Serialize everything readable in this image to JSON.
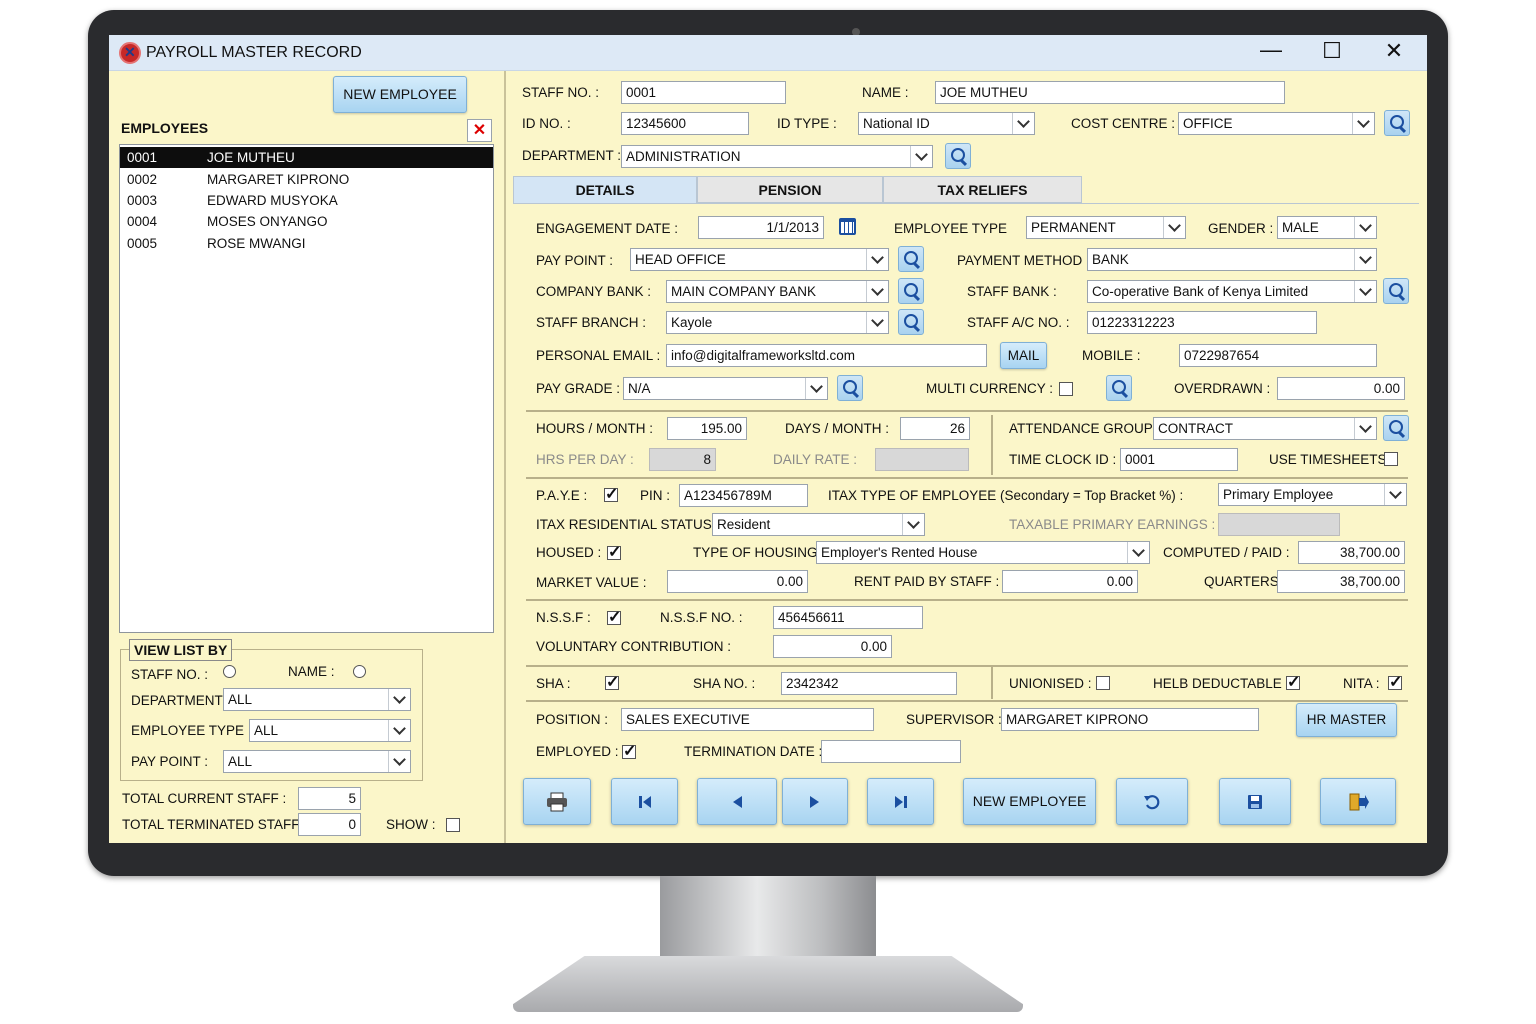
{
  "window": {
    "title": "PAYROLL MASTER RECORD"
  },
  "left": {
    "new_employee": "NEW EMPLOYEE",
    "employees_label": "EMPLOYEES",
    "employees": [
      {
        "no": "0001",
        "name": "JOE MUTHEU"
      },
      {
        "no": "0002",
        "name": "MARGARET KIPRONO"
      },
      {
        "no": "0003",
        "name": "EDWARD MUSYOKA"
      },
      {
        "no": "0004",
        "name": "MOSES ONYANGO"
      },
      {
        "no": "0005",
        "name": "ROSE MWANGI"
      }
    ],
    "view_list_by": "VIEW LIST BY",
    "staff_no_label": "STAFF NO. :",
    "name_label": "NAME :",
    "department_label": "DEPARTMENT",
    "department_value": "ALL",
    "employee_type_label": "EMPLOYEE TYPE",
    "employee_type_value": "ALL",
    "pay_point_label": "PAY POINT :",
    "pay_point_value": "ALL",
    "total_current_label": "TOTAL CURRENT STAFF :",
    "total_current_value": "5",
    "total_terminated_label": "TOTAL TERMINATED STAFF :",
    "total_terminated_value": "0",
    "show_label": "SHOW :"
  },
  "header": {
    "staff_no_label": "STAFF NO. :",
    "staff_no": "0001",
    "name_label": "NAME :",
    "name": "JOE MUTHEU",
    "id_no_label": "ID NO. :",
    "id_no": "12345600",
    "id_type_label": "ID TYPE :",
    "id_type": "National ID",
    "cost_centre_label": "COST CENTRE :",
    "cost_centre": "OFFICE",
    "department_label": "DEPARTMENT :",
    "department": "ADMINISTRATION"
  },
  "tabs": [
    "DETAILS",
    "PENSION",
    "TAX RELIEFS"
  ],
  "details": {
    "engagement_date_label": "ENGAGEMENT DATE :",
    "engagement_date": "1/1/2013",
    "employee_type_label": "EMPLOYEE TYPE",
    "employee_type": "PERMANENT",
    "gender_label": "GENDER :",
    "gender": "MALE",
    "pay_point_label": "PAY POINT :",
    "pay_point": "HEAD OFFICE",
    "payment_method_label": "PAYMENT METHOD :",
    "payment_method": "BANK",
    "company_bank_label": "COMPANY BANK :",
    "company_bank": "MAIN COMPANY BANK",
    "staff_bank_label": "STAFF BANK :",
    "staff_bank": "Co-operative Bank of Kenya Limited",
    "staff_branch_label": "STAFF BRANCH :",
    "staff_branch": "Kayole",
    "staff_ac_label": "STAFF A/C NO. :",
    "staff_ac": "01223312223",
    "email_label": "PERSONAL EMAIL :",
    "email": "info@digitalframeworksltd.com",
    "mail_button": "MAIL",
    "mobile_label": "MOBILE :",
    "mobile": "0722987654",
    "pay_grade_label": "PAY GRADE :",
    "pay_grade": "N/A",
    "multi_currency_label": "MULTI CURRENCY :",
    "overdrawn_label": "OVERDRAWN :",
    "overdrawn": "0.00",
    "hours_month_label": "HOURS / MONTH :",
    "hours_month": "195.00",
    "days_month_label": "DAYS / MONTH :",
    "days_month": "26",
    "attendance_group_label": "ATTENDANCE GROUP :",
    "attendance_group": "CONTRACT",
    "hrs_per_day_label": "HRS PER DAY :",
    "hrs_per_day": "8",
    "daily_rate_label": "DAILY RATE :",
    "time_clock_label": "TIME CLOCK ID :",
    "time_clock": "0001",
    "use_timesheets_label": "USE TIMESHEETS",
    "paye_label": "P.A.Y.E :",
    "pin_label": "PIN :",
    "pin": "A123456789M",
    "itax_type_label": "ITAX TYPE OF EMPLOYEE (Secondary = Top Bracket %) :",
    "itax_type": "Primary Employee",
    "itax_res_label": "ITAX RESIDENTIAL STATUS :",
    "itax_res": "Resident",
    "taxable_primary_label": "TAXABLE PRIMARY EARNINGS :",
    "housed_label": "HOUSED :",
    "housing_type_label": "TYPE OF HOUSING",
    "housing_type": "Employer's Rented House",
    "computed_label": "COMPUTED / PAID :",
    "computed": "38,700.00",
    "market_value_label": "MARKET VALUE :",
    "market_value": "0.00",
    "rent_paid_label": "RENT PAID BY STAFF :",
    "rent_paid": "0.00",
    "quarters_label": "QUARTERS :",
    "quarters": "38,700.00",
    "nssf_label": "N.S.S.F :",
    "nssf_no_label": "N.S.S.F NO. :",
    "nssf_no": "456456611",
    "voluntary_label": "VOLUNTARY CONTRIBUTION :",
    "voluntary": "0.00",
    "sha_label": "SHA :",
    "sha_no_label": "SHA NO. :",
    "sha_no": "2342342",
    "unionised_label": "UNIONISED :",
    "helb_label": "HELB DEDUCTABLE :",
    "nita_label": "NITA :",
    "position_label": "POSITION :",
    "position": "SALES EXECUTIVE",
    "supervisor_label": "SUPERVISOR :",
    "supervisor": "MARGARET KIPRONO",
    "hr_master_button": "HR MASTER",
    "employed_label": "EMPLOYED :",
    "termination_label": "TERMINATION DATE :"
  },
  "toolbar": {
    "new_employee": "NEW EMPLOYEE"
  }
}
